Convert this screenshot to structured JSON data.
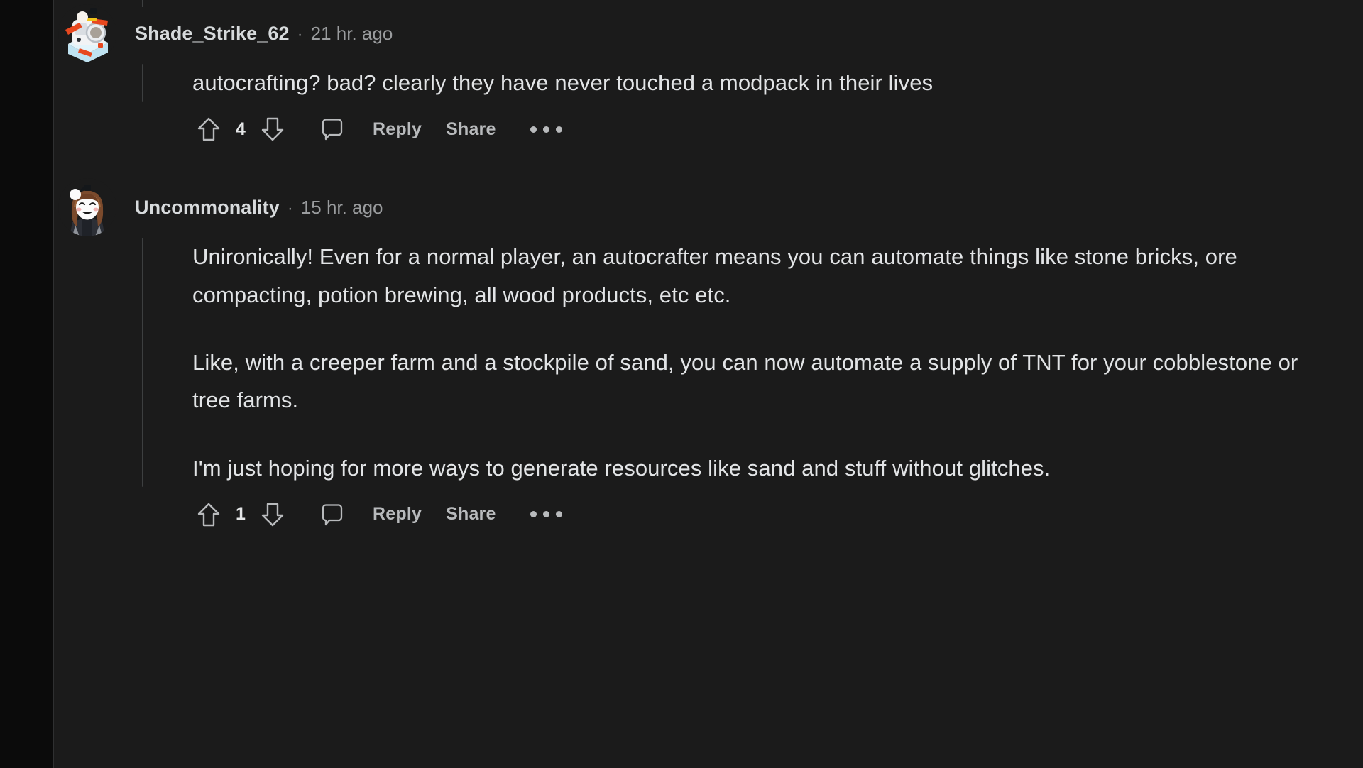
{
  "theme": {
    "page_background": "#0b0b0b",
    "column_background": "#1b1b1b",
    "text_primary": "#e2e4e6",
    "text_secondary": "#9a9c9e",
    "thread_line": "#3d3f40",
    "icon_color": "#b8babc"
  },
  "comments": [
    {
      "avatar_name": "avatar-shade-strike-62",
      "username": "Shade_Strike_62",
      "separator": "·",
      "timestamp": "21 hr. ago",
      "paragraphs": [
        "autocrafting? bad? clearly they have never touched a modpack in their lives"
      ],
      "actions": {
        "upvote_icon": "upvote-arrow-icon",
        "vote_count": "4",
        "downvote_icon": "downvote-arrow-icon",
        "comment_icon": "comment-bubble-icon",
        "reply_label": "Reply",
        "share_label": "Share",
        "more_icon": "more-options-icon"
      }
    },
    {
      "avatar_name": "avatar-uncommonality",
      "username": "Uncommonality",
      "separator": "·",
      "timestamp": "15 hr. ago",
      "paragraphs": [
        "Unironically! Even for a normal player, an autocrafter means you can automate things like stone bricks, ore compacting, potion brewing, all wood products, etc etc.",
        "Like, with a creeper farm and a stockpile of sand, you can now automate a supply of TNT for your cobblestone or tree farms.",
        "I'm just hoping for more ways to generate resources like sand and stuff without glitches."
      ],
      "actions": {
        "upvote_icon": "upvote-arrow-icon",
        "vote_count": "1",
        "downvote_icon": "downvote-arrow-icon",
        "comment_icon": "comment-bubble-icon",
        "reply_label": "Reply",
        "share_label": "Share",
        "more_icon": "more-options-icon"
      }
    }
  ]
}
